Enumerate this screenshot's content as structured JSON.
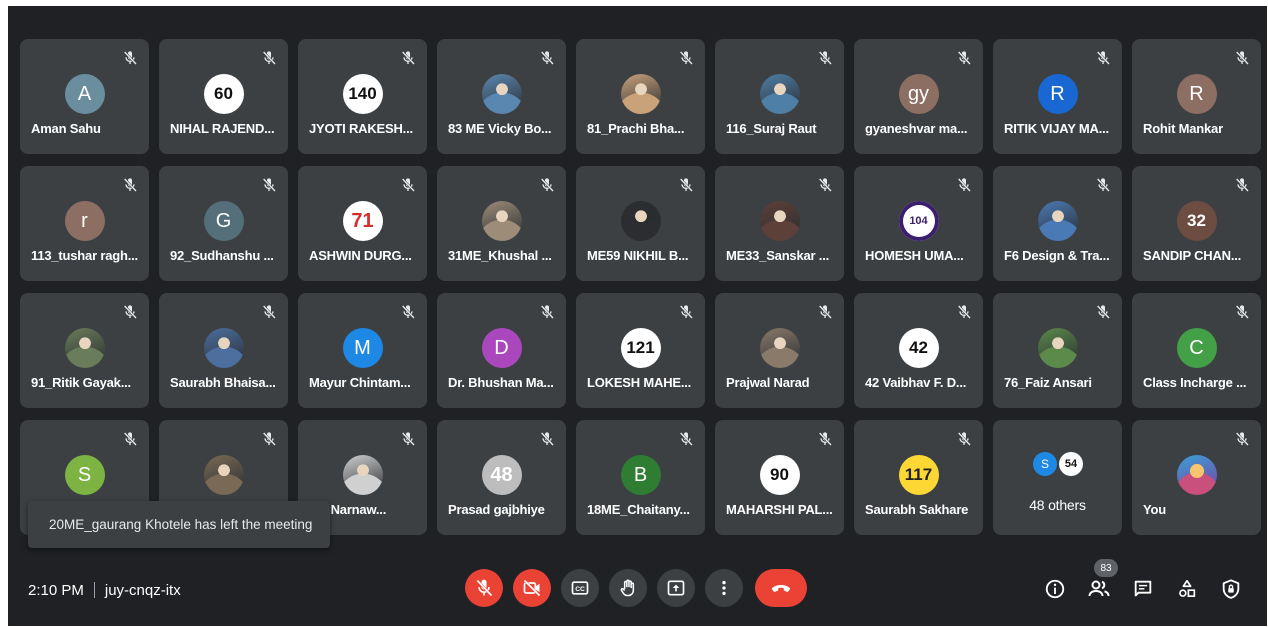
{
  "participants": [
    {
      "name": "Aman Sahu",
      "avatar": "A",
      "style": "letter",
      "color": "#6b8e9f"
    },
    {
      "name": "NIHAL RAJEND...",
      "avatar": "60",
      "style": "number"
    },
    {
      "name": "JYOTI RAKESH...",
      "avatar": "140",
      "style": "number"
    },
    {
      "name": "83 ME Vicky Bo...",
      "avatar": "",
      "style": "photo",
      "color": "#5a87b0"
    },
    {
      "name": "81_Prachi Bha...",
      "avatar": "",
      "style": "photo",
      "color": "#c9a27a"
    },
    {
      "name": "116_Suraj Raut",
      "avatar": "",
      "style": "photo",
      "color": "#4e7fa6"
    },
    {
      "name": "gyaneshvar ma...",
      "avatar": "gy",
      "style": "letter",
      "color": "#8d6e63"
    },
    {
      "name": "RITIK VIJAY MA...",
      "avatar": "R",
      "style": "letter",
      "color": "#1967d2"
    },
    {
      "name": "Rohit Mankar",
      "avatar": "R",
      "style": "letter",
      "color": "#8d6e63"
    },
    {
      "name": "113_tushar ragh...",
      "avatar": "r",
      "style": "letter",
      "color": "#8d6e63"
    },
    {
      "name": "92_Sudhanshu ...",
      "avatar": "G",
      "style": "letter",
      "color": "#546e7a"
    },
    {
      "name": "ASHWIN DURG...",
      "avatar": "71",
      "style": "number-red"
    },
    {
      "name": "31ME_Khushal ...",
      "avatar": "",
      "style": "photo",
      "color": "#9c8c78"
    },
    {
      "name": "ME59 NIKHIL B...",
      "avatar": "",
      "style": "photo",
      "color": "#2b2d30"
    },
    {
      "name": "ME33_Sanskar ...",
      "avatar": "",
      "style": "photo",
      "color": "#5d4037"
    },
    {
      "name": "HOMESH UMA...",
      "avatar": "104",
      "style": "number-ring"
    },
    {
      "name": "F6 Design & Tra...",
      "avatar": "",
      "style": "photo",
      "color": "#4a7ab5"
    },
    {
      "name": "SANDIP CHAN...",
      "avatar": "32",
      "style": "number-brown"
    },
    {
      "name": "91_Ritik Gayak...",
      "avatar": "",
      "style": "photo",
      "color": "#6a7d5a"
    },
    {
      "name": "Saurabh Bhaisa...",
      "avatar": "",
      "style": "photo",
      "color": "#4c6fa0"
    },
    {
      "name": "Mayur Chintam...",
      "avatar": "M",
      "style": "letter",
      "color": "#1e88e5"
    },
    {
      "name": "Dr. Bhushan Ma...",
      "avatar": "D",
      "style": "letter",
      "color": "#ab47bc"
    },
    {
      "name": "LOKESH MAHE...",
      "avatar": "121",
      "style": "number"
    },
    {
      "name": "Prajwal Narad",
      "avatar": "",
      "style": "photo",
      "color": "#8a7a6a"
    },
    {
      "name": "42 Vaibhav F. D...",
      "avatar": "42",
      "style": "number"
    },
    {
      "name": "76_Faiz Ansari",
      "avatar": "",
      "style": "photo",
      "color": "#5b8a4a"
    },
    {
      "name": "Class Incharge ...",
      "avatar": "C",
      "style": "letter",
      "color": "#43a047"
    },
    {
      "name": "",
      "avatar": "S",
      "style": "letter",
      "color": "#7cb342"
    },
    {
      "name": "",
      "avatar": "",
      "style": "photo",
      "color": "#7a6a55"
    },
    {
      "name": "nal Narnaw...",
      "avatar": "",
      "style": "photo",
      "color": "#d0d0d0"
    },
    {
      "name": "Prasad gajbhiye",
      "avatar": "48",
      "style": "number-grey"
    },
    {
      "name": "18ME_Chaitany...",
      "avatar": "B",
      "style": "letter",
      "color": "#2e7d32"
    },
    {
      "name": "MAHARSHI PAL...",
      "avatar": "90",
      "style": "number"
    },
    {
      "name": "Saurabh Sakhare",
      "avatar": "117",
      "style": "number-yellow"
    }
  ],
  "others_tile": {
    "label": "48 others",
    "mini_a": "S",
    "mini_b": "54"
  },
  "self_tile": {
    "name": "You"
  },
  "toast": "20ME_gaurang Khotele has left the meeting",
  "meeting": {
    "time": "2:10 PM",
    "code": "juy-cnqz-itx"
  },
  "people_count": "83",
  "colors": {
    "background": "#202124",
    "tile": "#3c4043",
    "danger": "#ea4335"
  }
}
